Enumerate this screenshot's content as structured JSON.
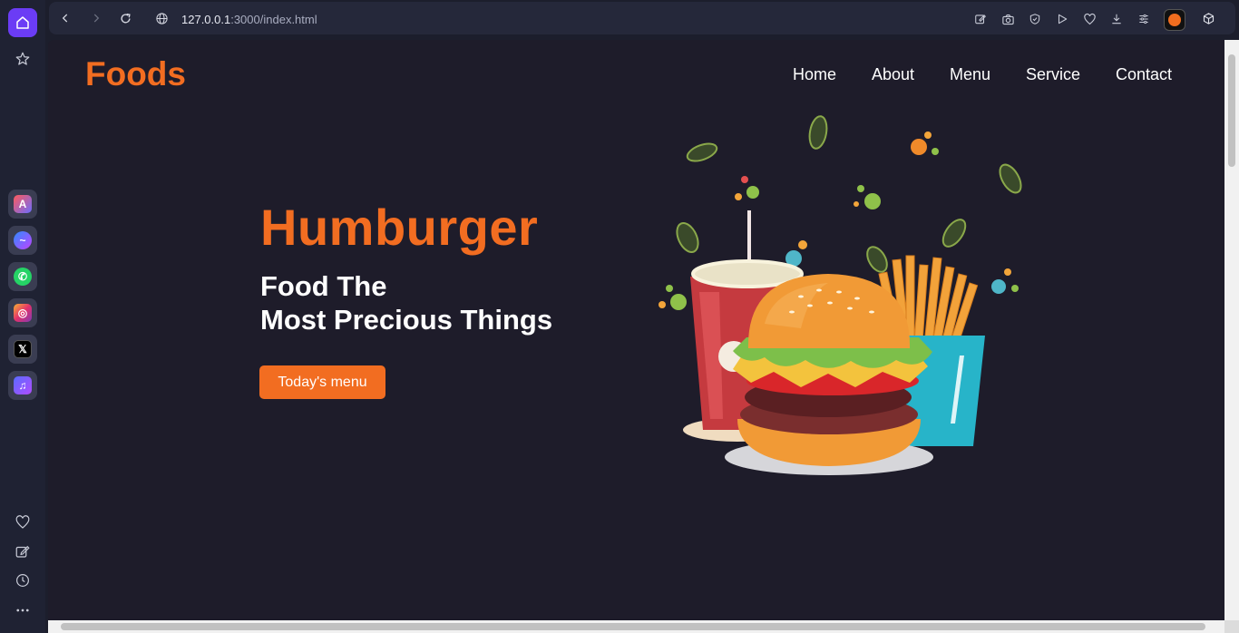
{
  "browser": {
    "url_host": "127.0.0.1",
    "url_rest": ":3000/index.html"
  },
  "site": {
    "logo": "Foods",
    "nav": [
      "Home",
      "About",
      "Menu",
      "Service",
      "Contact"
    ],
    "hero": {
      "title": "Humburger",
      "subtitle_line1": "Food The",
      "subtitle_line2": "Most Precious Things",
      "cta": "Today's menu"
    }
  },
  "colors": {
    "accent": "#f26d21",
    "page_bg": "#1e1c2a",
    "browser_accent": "#6b3cf5"
  },
  "icons": {
    "sidebar_top": [
      "home-icon",
      "star-icon"
    ],
    "sidebar_apps": [
      "aria-icon",
      "messenger-icon",
      "whatsapp-icon",
      "instagram-icon",
      "x-icon",
      "music-icon"
    ],
    "sidebar_bottom": [
      "heart-icon",
      "edit-icon",
      "history-icon",
      "more-icon"
    ],
    "toolbar": [
      "edit-icon",
      "camera-icon",
      "shield-icon",
      "play-icon",
      "heart-icon",
      "download-icon",
      "menu-icon"
    ]
  }
}
